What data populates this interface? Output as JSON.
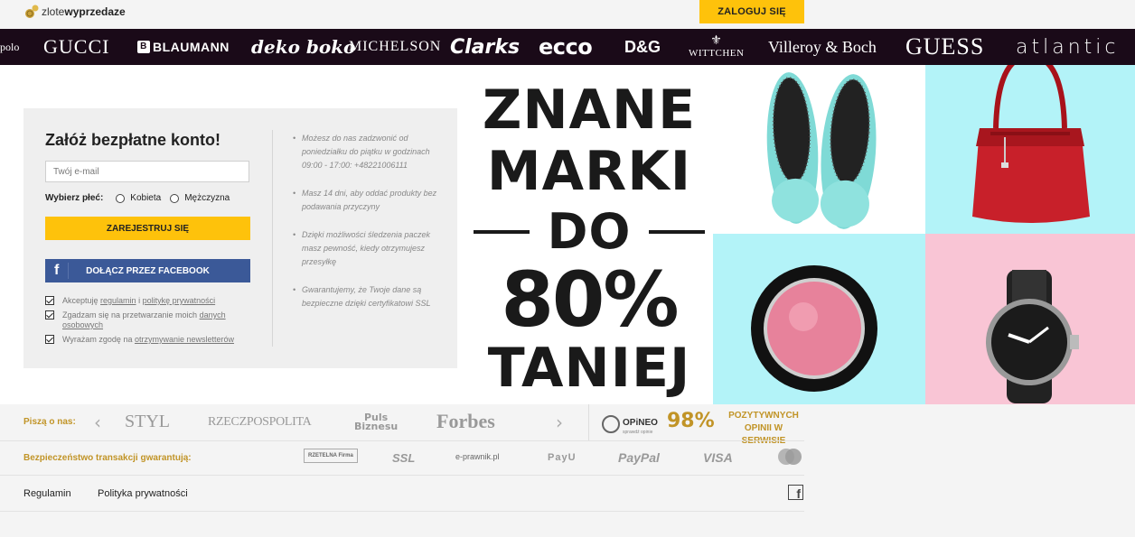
{
  "header": {
    "logo": {
      "light": "zlote",
      "bold": "wyprzedaze"
    },
    "login_label": "ZALOGUJ SIĘ"
  },
  "brands": {
    "polo": "polo",
    "gucci": "GUCCI",
    "blaumann_mark": "B",
    "blaumann": "BLAUMANN",
    "deko_boko": "deko boko",
    "michelson": "MICHELSON",
    "clarks": "Clarks",
    "ecco": "ecco",
    "dg": "D&G",
    "wittchen": "WITTCHEN",
    "villeroy": "Villeroy & Boch",
    "guess": "GUESS",
    "atlantic": "atlantic"
  },
  "register": {
    "title": "Załóż bezpłatne konto!",
    "email_placeholder": "Twój e-mail",
    "gender_label": "Wybierz płeć:",
    "gender_female": "Kobieta",
    "gender_male": "Mężczyzna",
    "register_label": "ZAREJESTRUJ SIĘ",
    "facebook_icon": "f",
    "facebook_label": "DOŁĄCZ PRZEZ FACEBOOK",
    "consents": [
      {
        "before": "Akceptuję ",
        "link1": "regulamin",
        "middle": " i ",
        "link2": "politykę prywatności"
      },
      {
        "before": "Zgadzam się na przetwarzanie moich ",
        "link1": "danych osobowych"
      },
      {
        "before": "Wyrażam zgodę na ",
        "link1": "otrzymywanie newsletterów"
      }
    ]
  },
  "benefits": [
    "Możesz do nas zadzwonić od poniedziałku do piątku w godzinach 09:00 - 17:00: +48221006111",
    "Masz 14 dni, aby oddać produkty bez podawania przyczyny",
    "Dzięki możliwości śledzenia paczek masz pewność, kiedy otrzymujesz przesyłkę",
    "Gwarantujemy, że Twoje dane są bezpieczne dzięki certyfikatowi SSL"
  ],
  "promo": {
    "line1": "ZNANE",
    "line2": "MARKI",
    "line3": "DO",
    "line4": "80%",
    "line5": "TANIEJ"
  },
  "press": {
    "label": "Piszą o nas:",
    "prev_arrow": "‹",
    "next_arrow": "›",
    "logos": {
      "styl": "STYL",
      "rzeczpospolita": "RZECZPOSPOLITA",
      "puls1": "Puls",
      "puls2": "Biznesu",
      "forbes": "Forbes"
    }
  },
  "opineo": {
    "name": "OPiNEO",
    "sub": "sprawdź opinie",
    "percent": "98%",
    "text1": "POZYTYWNYCH",
    "text2": "OPINII W SERWISIE"
  },
  "security": {
    "label": "Bezpieczeństwo transakcji gwarantują:",
    "rzetelna": "RZETELNA Firma",
    "ssl": "SSL",
    "eprawnik": "e-prawnik.pl",
    "payu": "PayU",
    "paypal": "PayPal",
    "visa": "VISA",
    "mastercard": "MasterCard"
  },
  "footer": {
    "regulamin": "Regulamin",
    "polityka": "Polityka prywatności",
    "facebook": "f"
  },
  "colors": {
    "accent_yellow": "#fec20b",
    "gold_text": "#c19427",
    "facebook_blue": "#3b5998",
    "brand_bar": "#1a0a18",
    "tile_cyan": "#b3f3f8",
    "tile_pink": "#f9c5d5"
  }
}
